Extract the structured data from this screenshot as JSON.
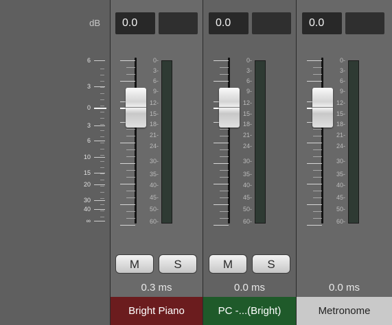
{
  "scale": {
    "unit_label": "dB",
    "labels": [
      "6",
      "3",
      "0",
      "3",
      "6",
      "10",
      "15",
      "20",
      "30",
      "40",
      "∞"
    ]
  },
  "meter_scale_labels": [
    "0",
    "3",
    "6",
    "9",
    "12",
    "15",
    "18",
    "21",
    "24",
    "30",
    "35",
    "40",
    "45",
    "50",
    "60"
  ],
  "channels": [
    {
      "name": "Bright Piano",
      "volume": "0.0",
      "mute_label": "M",
      "solo_label": "S",
      "delay": "0.3 ms",
      "name_color": "#6b1c1e",
      "selected": true,
      "has_mute_solo": true
    },
    {
      "name": "PC -...(Bright)",
      "volume": "0.0",
      "mute_label": "M",
      "solo_label": "S",
      "delay": "0.0 ms",
      "name_color": "#1f5a2a",
      "selected": false,
      "has_mute_solo": true
    },
    {
      "name": "Metronome",
      "volume": "0.0",
      "delay": "0.0 ms",
      "name_color": "#c9c9c9",
      "selected": false,
      "has_mute_solo": false
    }
  ]
}
